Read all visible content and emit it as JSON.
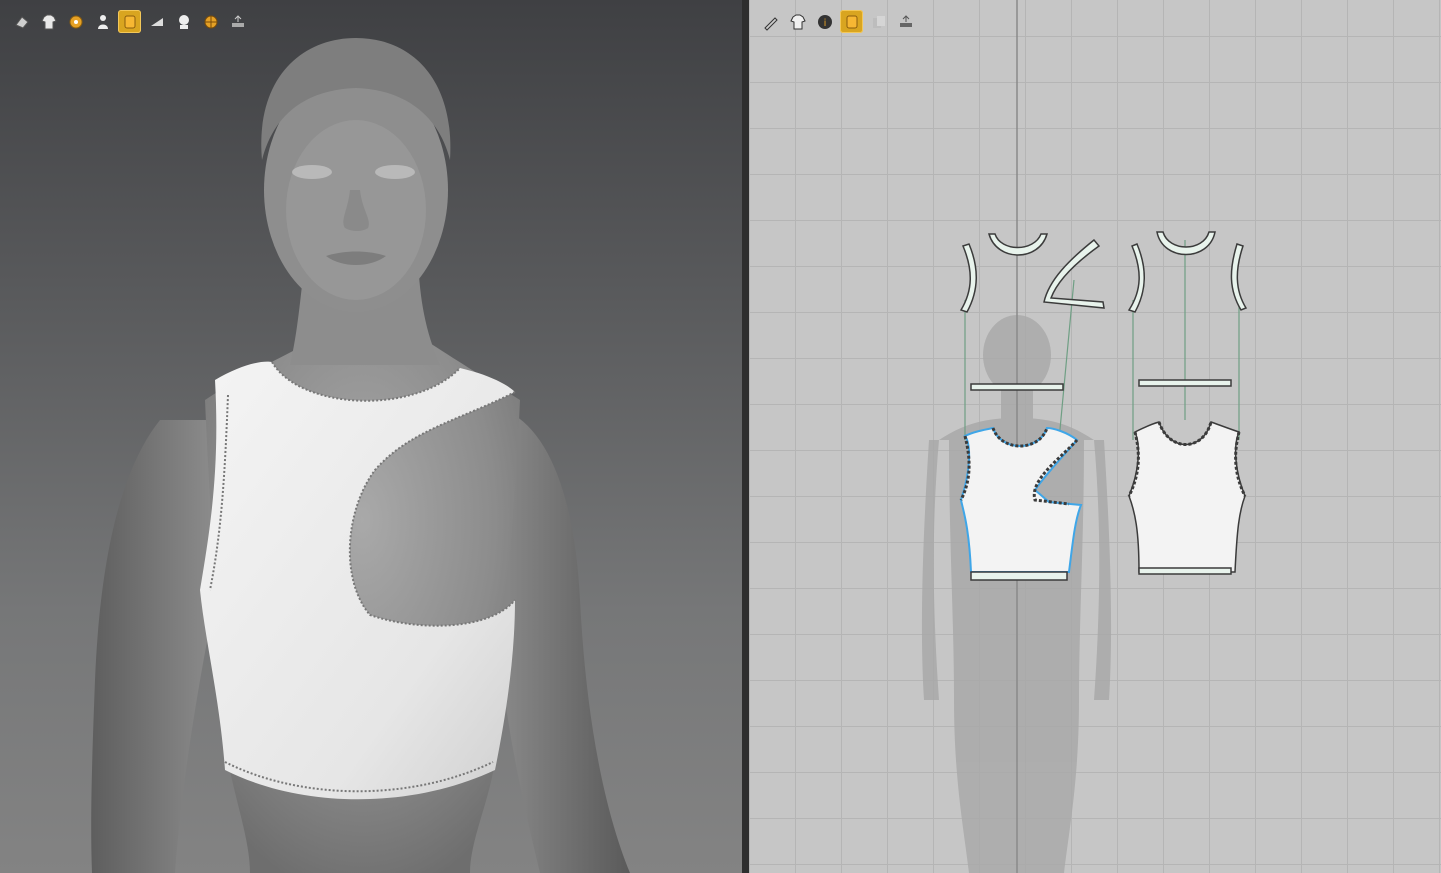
{
  "app": {
    "accent_color": "#e0a824",
    "pattern_outline_color": "#9fd6b4",
    "selection_color": "#3fa6e8"
  },
  "toolbar_3d": {
    "buttons": [
      {
        "icon": "select-mesh-icon",
        "active": false
      },
      {
        "icon": "garment-icon",
        "active": false
      },
      {
        "icon": "sewing-icon",
        "active": false
      },
      {
        "icon": "avatar-icon",
        "active": false
      },
      {
        "icon": "texture-icon",
        "active": true
      },
      {
        "icon": "fold-icon",
        "active": false
      },
      {
        "icon": "avatar-silhouette-icon",
        "active": false
      },
      {
        "icon": "globe-icon",
        "active": false
      },
      {
        "icon": "measure-icon",
        "active": false
      }
    ]
  },
  "toolbar_2d": {
    "buttons": [
      {
        "icon": "edit-pattern-icon",
        "active": false
      },
      {
        "icon": "garment-2d-icon",
        "active": false
      },
      {
        "icon": "info-icon",
        "active": false
      },
      {
        "icon": "texture-2d-icon",
        "active": true
      },
      {
        "icon": "duplicate-icon",
        "active": false
      },
      {
        "icon": "measure-2d-icon",
        "active": false
      }
    ]
  }
}
